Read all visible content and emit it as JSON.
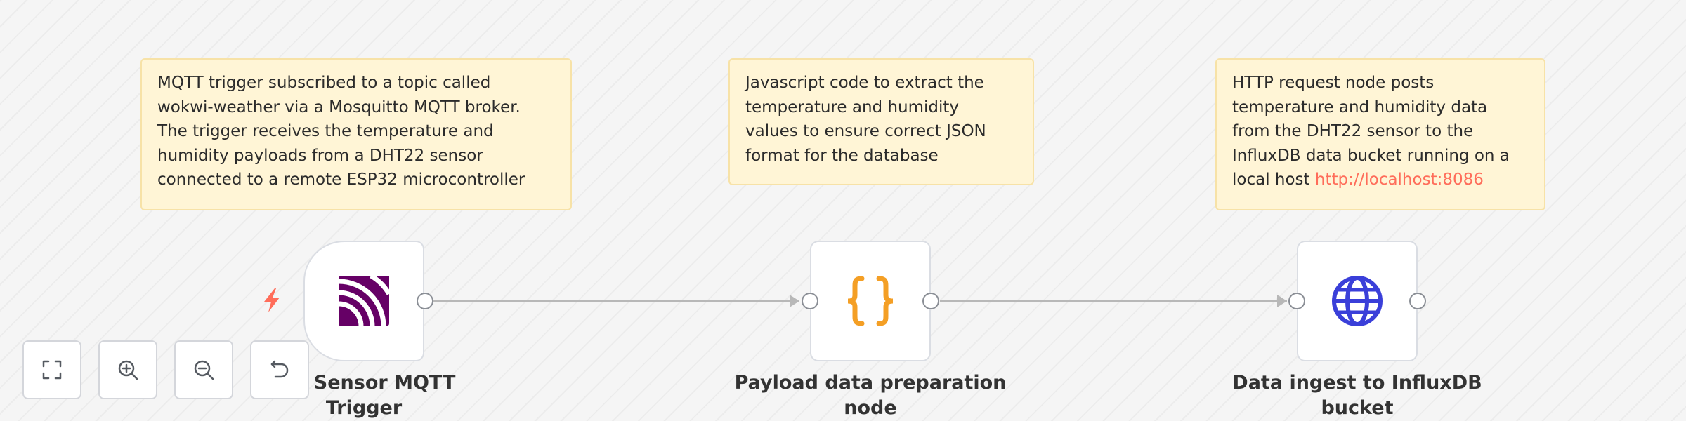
{
  "sticky_notes": [
    {
      "lines": [
        "MQTT trigger subscribed to a topic called",
        "wokwi-weather via a Mosquitto MQTT broker.",
        "The trigger receives the temperature and",
        "humidity payloads from a DHT22 sensor",
        "connected to a remote ESP32 microcontroller"
      ]
    },
    {
      "lines": [
        "Javascript code to extract the",
        "temperature and humidity",
        "values to ensure correct JSON",
        "format for the database"
      ]
    },
    {
      "lines": [
        "HTTP request node posts",
        "temperature and humidity data",
        "from the DHT22 sensor to the",
        "InfluxDB data bucket running on a"
      ],
      "last_line_prefix": "local host ",
      "link_text": "http://localhost:8086"
    }
  ],
  "nodes": [
    {
      "label_line1": "ote Sensor MQTT",
      "label_line2": "Trigger",
      "icon": "mqtt-icon",
      "icon_color": "#660066",
      "is_trigger": true
    },
    {
      "label_line1": "Payload data preparation",
      "label_line2": "node",
      "icon": "code-braces-icon",
      "icon_color": "#f49f25"
    },
    {
      "label_line1": "Data ingest to InfluxDB",
      "label_line2": "bucket",
      "icon": "globe-icon",
      "icon_color": "#3a3fd9"
    }
  ],
  "trigger_badge": {
    "icon": "lightning-bolt-icon",
    "color": "#ff6d5a"
  },
  "controls": [
    {
      "name": "fit-to-view",
      "icon": "fullscreen-corners-icon"
    },
    {
      "name": "zoom-in",
      "icon": "zoom-in-icon"
    },
    {
      "name": "zoom-out",
      "icon": "zoom-out-icon"
    },
    {
      "name": "reset-zoom",
      "icon": "undo-icon"
    }
  ],
  "colors": {
    "sticky_background": "#fff5d6",
    "sticky_border": "#f7e2a7",
    "link": "#ff6d5a",
    "connection": "#b8b8b8",
    "canvas": "#f5f5f5"
  }
}
